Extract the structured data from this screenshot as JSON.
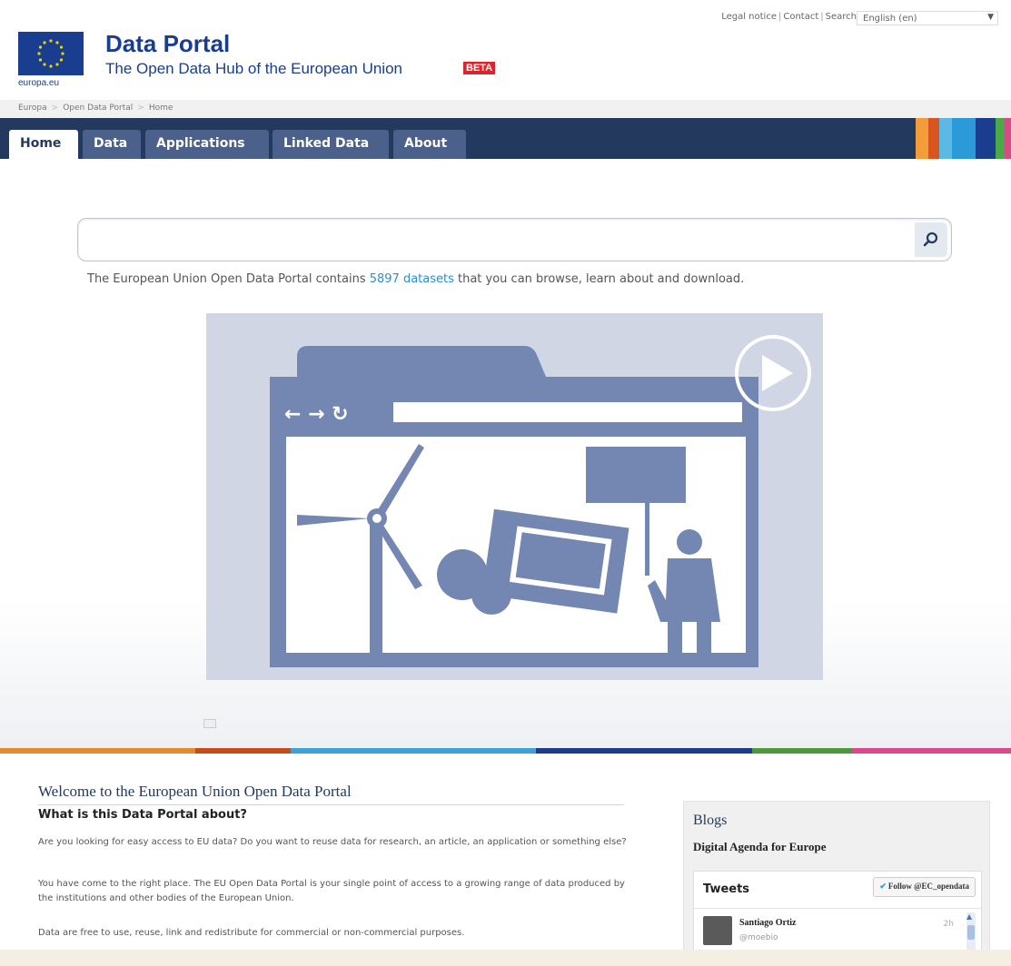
{
  "topbar": {
    "links": [
      "Legal notice",
      "Contact",
      "Search"
    ],
    "language": "English (en)"
  },
  "header": {
    "logo_text": "europa.eu",
    "title": "Data Portal",
    "subtitle": "The Open Data Hub of the European Union",
    "badge": "BETA"
  },
  "breadcrumb": [
    "Europa",
    "Open Data Portal",
    "Home"
  ],
  "nav": {
    "tabs": [
      {
        "label": "Home",
        "active": true
      },
      {
        "label": "Data",
        "active": false
      },
      {
        "label": "Applications",
        "active": false
      },
      {
        "label": "Linked Data",
        "active": false
      },
      {
        "label": "About",
        "active": false
      }
    ]
  },
  "search": {
    "placeholder": ""
  },
  "intro": {
    "before": "The European Union Open Data Portal contains ",
    "link": "5897 datasets",
    "after": " that you can browse, learn about and download."
  },
  "colors": {
    "nav_bg": "#233a5e",
    "tab_bg": "#4b608a",
    "brand_blue": "#1a3e8f",
    "link": "#2a8ed6",
    "video_bg": "#d1d6e4",
    "illustration": "#7486b2"
  },
  "welcome": {
    "title": "Welcome to the European Union Open Data Portal",
    "subtitle": "What is this Data Portal about?",
    "paragraphs": [
      "Are you looking for easy access to EU data? Do you want to reuse data for research, an article, an application or something else?",
      "You have come to the right place. The EU Open Data Portal is your single point of access to a growing range of data produced by the institutions and other bodies of the European Union.",
      "Data are free to use, reuse, link and redistribute for commercial or non-commercial purposes."
    ]
  },
  "sidebar": {
    "title": "Blogs",
    "subtitle": "Digital Agenda for Europe",
    "tweets_label": "Tweets",
    "follow_label": "Follow @EC_opendata",
    "tweet": {
      "name": "Santiago Ortiz",
      "handle": "@moebio",
      "time": "2h"
    }
  }
}
